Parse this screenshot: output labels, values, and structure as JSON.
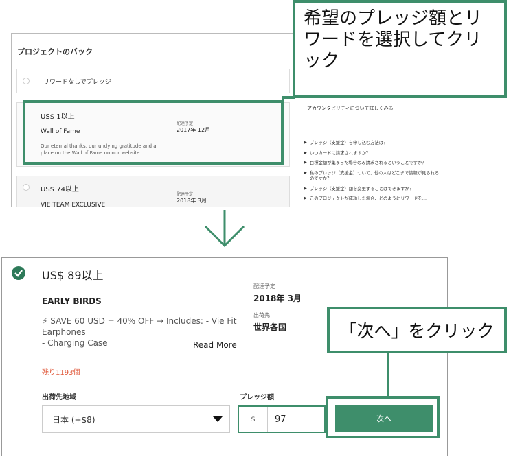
{
  "top_panel": {
    "title": "プロジェクトのバック",
    "no_reward_label": "リワードなしでプレッジ",
    "reward1": {
      "price": "US$ 1以上",
      "name": "Wall of Fame",
      "description": "Our eternal thanks, our undying gratitude and a place on the Wall of Fame on our website.",
      "delivery_label": "配達予定",
      "delivery_date": "2017年 12月"
    },
    "reward2": {
      "price": "US$ 74以上",
      "name": "VIE TEAM EXCLUSIVE",
      "delivery_label": "配達予定",
      "delivery_date": "2018年 3月"
    },
    "accessibility_link": "アカウンタビリティについて詳しくみる",
    "faq": [
      "プレッジ（支援金）を申し込む方法は？",
      "いつカードに請求されますか？",
      "目標金額が集まった場合のみ請求されるということですか？",
      "私のプレッジ（支援金）ついて、他の人はどこまで情報が見られるのですか？",
      "プレッジ（支援金）額を変更することはできますか？",
      "このプロジェクトが成功した場合、どのようにリワードを…"
    ]
  },
  "callouts": {
    "select": "希望のプレッジ額とリワードを選択してクリック",
    "next": "「次へ」をクリック"
  },
  "bottom_panel": {
    "price_title": "US$ 89以上",
    "reward_name": "EARLY BIRDS",
    "description_line1": "⚡ SAVE 60 USD = 40% OFF → Includes: - Vie Fit Earphones",
    "description_line2": "- Charging Case",
    "read_more": "Read More",
    "remaining": "残り1193個",
    "delivery_label": "配達予定",
    "delivery_date": "2018年 3月",
    "ship_label": "出荷先",
    "ship_value": "世界各国",
    "region_label": "出荷先地域",
    "region_value": "日本 (+$8)",
    "pledge_label": "プレッジ額",
    "currency_prefix": "$",
    "pledge_value": "97",
    "next_button": "次へ"
  },
  "colors": {
    "accent_green": "#3e8e6b",
    "check_green": "#2d7a59",
    "remaining_red": "#e05a3c"
  }
}
